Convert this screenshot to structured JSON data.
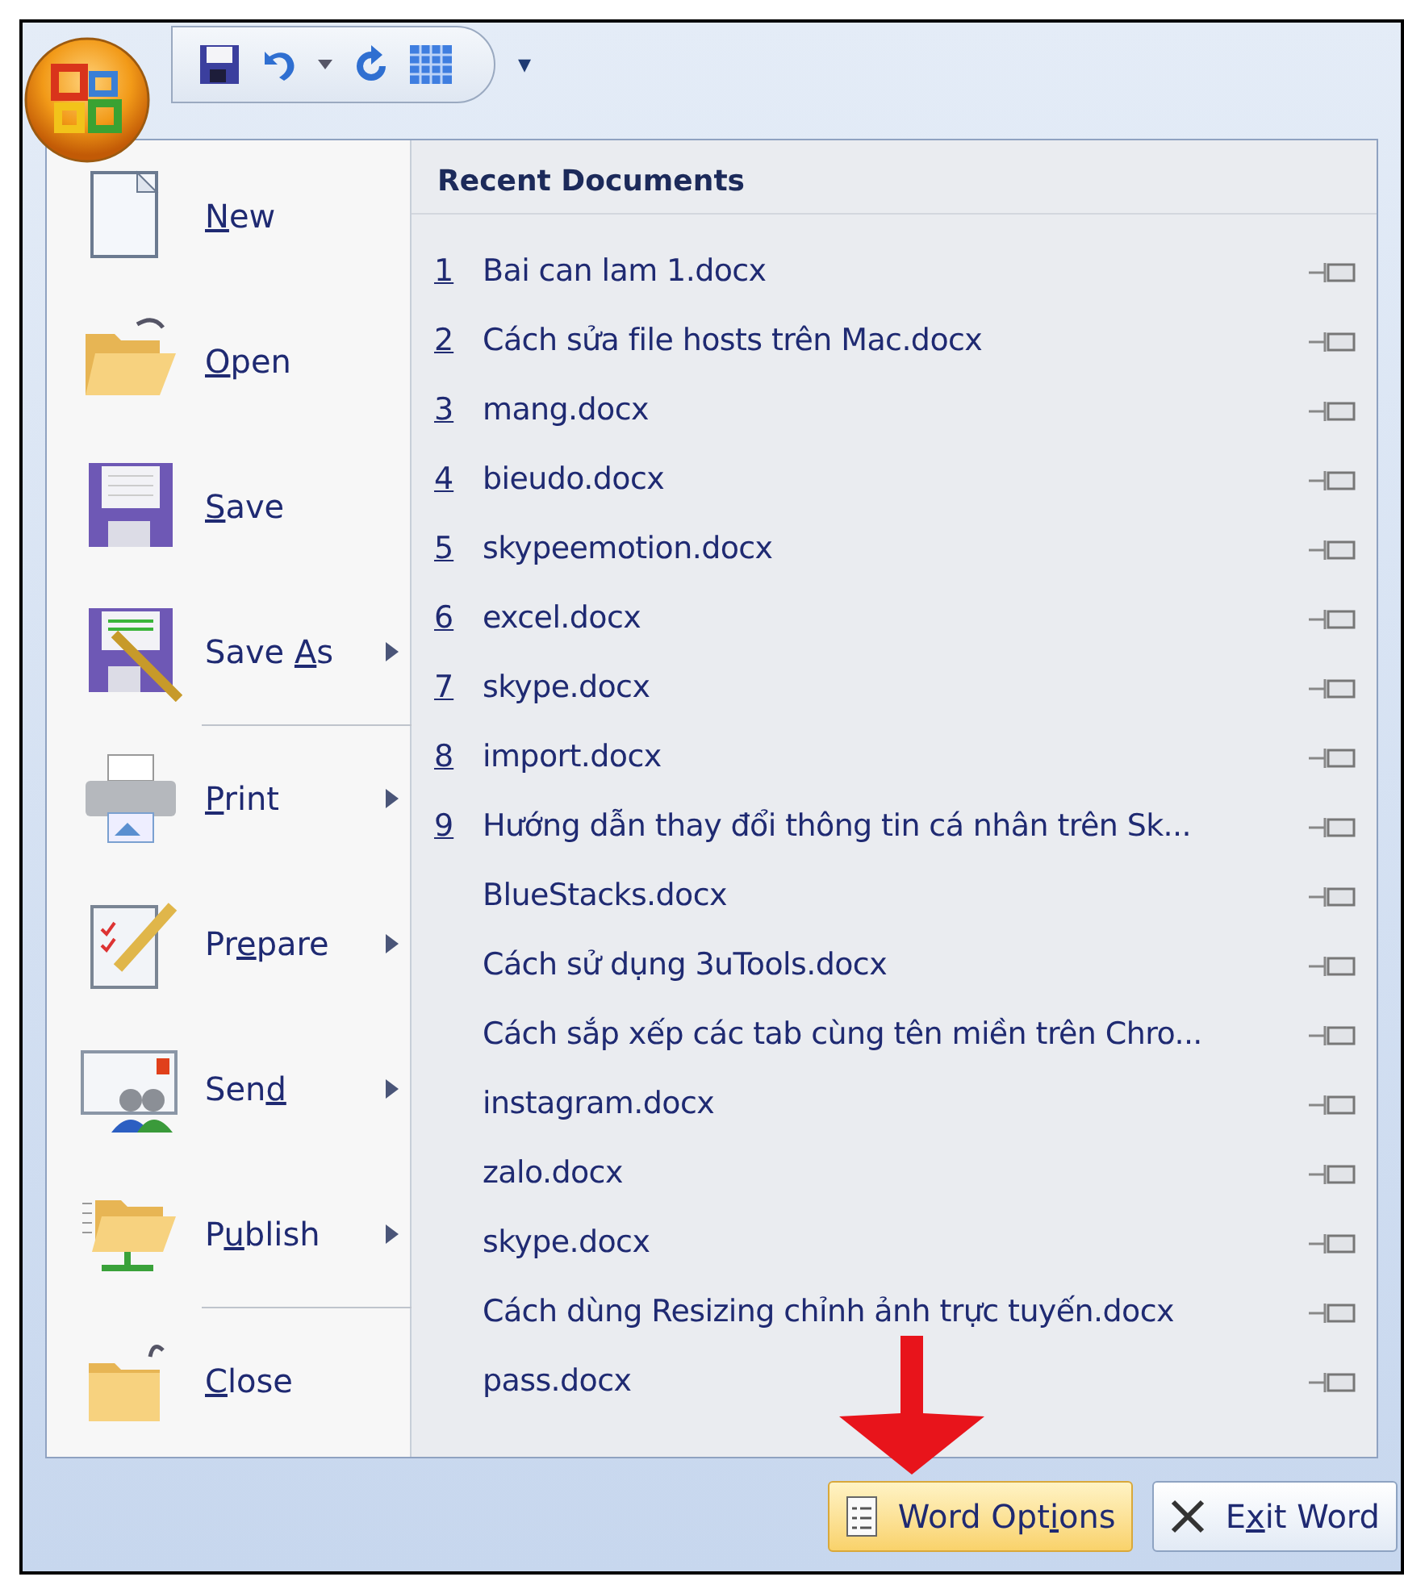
{
  "quick_access_toolbar": {
    "buttons": [
      {
        "kind": "save"
      },
      {
        "kind": "undo"
      },
      {
        "kind": "dropdown"
      },
      {
        "kind": "redo"
      },
      {
        "kind": "table"
      }
    ],
    "customize": "▾"
  },
  "menu": {
    "commands": [
      {
        "kind": "new",
        "access_key": "N",
        "label_after": "ew",
        "submenu": false,
        "divider_after": false
      },
      {
        "kind": "open",
        "access_key": "O",
        "label_after": "pen",
        "submenu": false,
        "divider_after": false
      },
      {
        "kind": "save",
        "access_key": "S",
        "label_after": "ave",
        "submenu": false,
        "divider_after": false
      },
      {
        "kind": "saveas",
        "label_before": "Save ",
        "access_key": "A",
        "label_after": "s",
        "submenu": true,
        "divider_after": true
      },
      {
        "kind": "print",
        "access_key": "P",
        "label_after": "rint",
        "submenu": true,
        "divider_after": false
      },
      {
        "kind": "prepare",
        "label_before": "Pr",
        "access_key": "e",
        "label_after": "pare",
        "submenu": true,
        "divider_after": false
      },
      {
        "kind": "send",
        "label_before": "Sen",
        "access_key": "d",
        "submenu": true,
        "divider_after": false
      },
      {
        "kind": "publish",
        "label_before": "P",
        "access_key": "u",
        "label_after": "blish",
        "submenu": true,
        "divider_after": true
      },
      {
        "kind": "close",
        "access_key": "C",
        "label_after": "lose",
        "submenu": false,
        "divider_after": false
      }
    ],
    "recent_documents": {
      "title": "Recent Documents",
      "items": [
        {
          "number": "1",
          "name": "Bai can lam 1.docx"
        },
        {
          "number": "2",
          "name": "Cách sửa file hosts trên Mac.docx"
        },
        {
          "number": "3",
          "name": "mang.docx"
        },
        {
          "number": "4",
          "name": "bieudo.docx"
        },
        {
          "number": "5",
          "name": "skypeemotion.docx"
        },
        {
          "number": "6",
          "name": "excel.docx"
        },
        {
          "number": "7",
          "name": "skype.docx"
        },
        {
          "number": "8",
          "name": "import.docx"
        },
        {
          "number": "9",
          "name": "Hướng dẫn thay đổi thông tin cá nhân trên Sk..."
        },
        {
          "name": "BlueStacks.docx"
        },
        {
          "name": "Cách sử dụng 3uTools.docx"
        },
        {
          "name": "Cách sắp xếp các tab cùng tên miền trên Chro..."
        },
        {
          "name": "instagram.docx"
        },
        {
          "name": "zalo.docx"
        },
        {
          "name": "skype.docx"
        },
        {
          "name": "Cách dùng Resizing chỉnh ảnh trực tuyến.docx"
        },
        {
          "name": "pass.docx"
        }
      ]
    },
    "footer_buttons": [
      {
        "kind": "options",
        "label_before": "Word Opt",
        "access_key": "i",
        "label_after": "ons",
        "highlighted": true
      },
      {
        "kind": "exit",
        "label_before": "E",
        "access_key": "x",
        "label_after": "it Word",
        "highlighted": false
      }
    ]
  }
}
